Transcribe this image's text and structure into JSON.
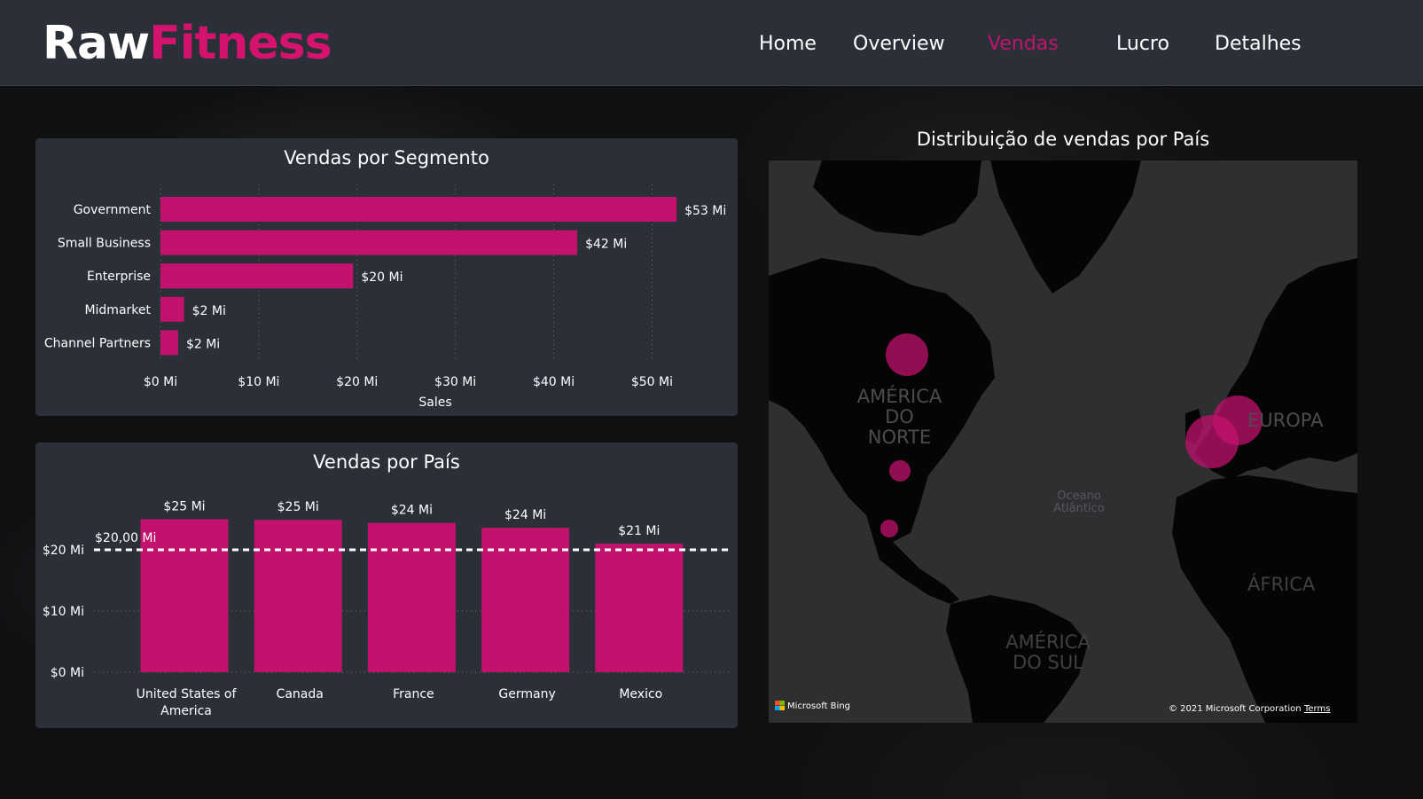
{
  "brand": {
    "part1": "Raw",
    "part2": "Fitness",
    "accent": "#d4136f"
  },
  "nav": {
    "items": [
      {
        "label": "Home",
        "active": false
      },
      {
        "label": "Overview",
        "active": false
      },
      {
        "label": "Vendas",
        "active": true
      },
      {
        "label": "Lucro",
        "active": false
      },
      {
        "label": "Detalhes",
        "active": false
      }
    ]
  },
  "segment_chart": {
    "title": "Vendas por Segmento"
  },
  "country_chart": {
    "title": "Vendas por País"
  },
  "map": {
    "title": "Distribuição de vendas por País",
    "labels": {
      "north_america": "AMÉRICA DO NORTE",
      "europe": "EUROPA",
      "ocean": "Oceano Atlântico",
      "africa": "ÁFRICA",
      "south_america": "AMÉRICA DO SUL"
    },
    "provider": "Microsoft Bing",
    "copyright": "© 2021 Microsoft Corporation",
    "terms": "Terms"
  },
  "chart_data": [
    {
      "type": "bar",
      "orientation": "horizontal",
      "title": "Vendas por Segmento",
      "categories": [
        "Government",
        "Small Business",
        "Enterprise",
        "Midmarket",
        "Channel Partners"
      ],
      "values": [
        52.5,
        42.4,
        19.6,
        2.4,
        1.8
      ],
      "data_labels": [
        "$53 Mi",
        "$42 Mi",
        "$20 Mi",
        "$2 Mi",
        "$2 Mi"
      ],
      "xlabel": "Sales",
      "ticks": [
        0,
        10,
        20,
        30,
        40,
        50
      ],
      "tick_labels": [
        "$0 Mi",
        "$10 Mi",
        "$20 Mi",
        "$30 Mi",
        "$40 Mi",
        "$50 Mi"
      ],
      "xlim": [
        0,
        57
      ],
      "grid": true,
      "color": "#c2126e"
    },
    {
      "type": "bar",
      "orientation": "vertical",
      "title": "Vendas por País",
      "categories": [
        "United States of America",
        "Canada",
        "France",
        "Germany",
        "Mexico"
      ],
      "values": [
        25.0,
        24.9,
        24.4,
        23.6,
        21.0
      ],
      "data_labels": [
        "$25 Mi",
        "$25 Mi",
        "$24 Mi",
        "$24 Mi",
        "$21 Mi"
      ],
      "ticks": [
        0,
        10,
        20
      ],
      "tick_labels": [
        "$0 Mi",
        "$10 Mi",
        "$20 Mi"
      ],
      "ylim": [
        0,
        25.8
      ],
      "reference_line": {
        "value": 20,
        "label": "$20,00 Mi"
      },
      "grid": true,
      "color": "#c2126e"
    }
  ]
}
